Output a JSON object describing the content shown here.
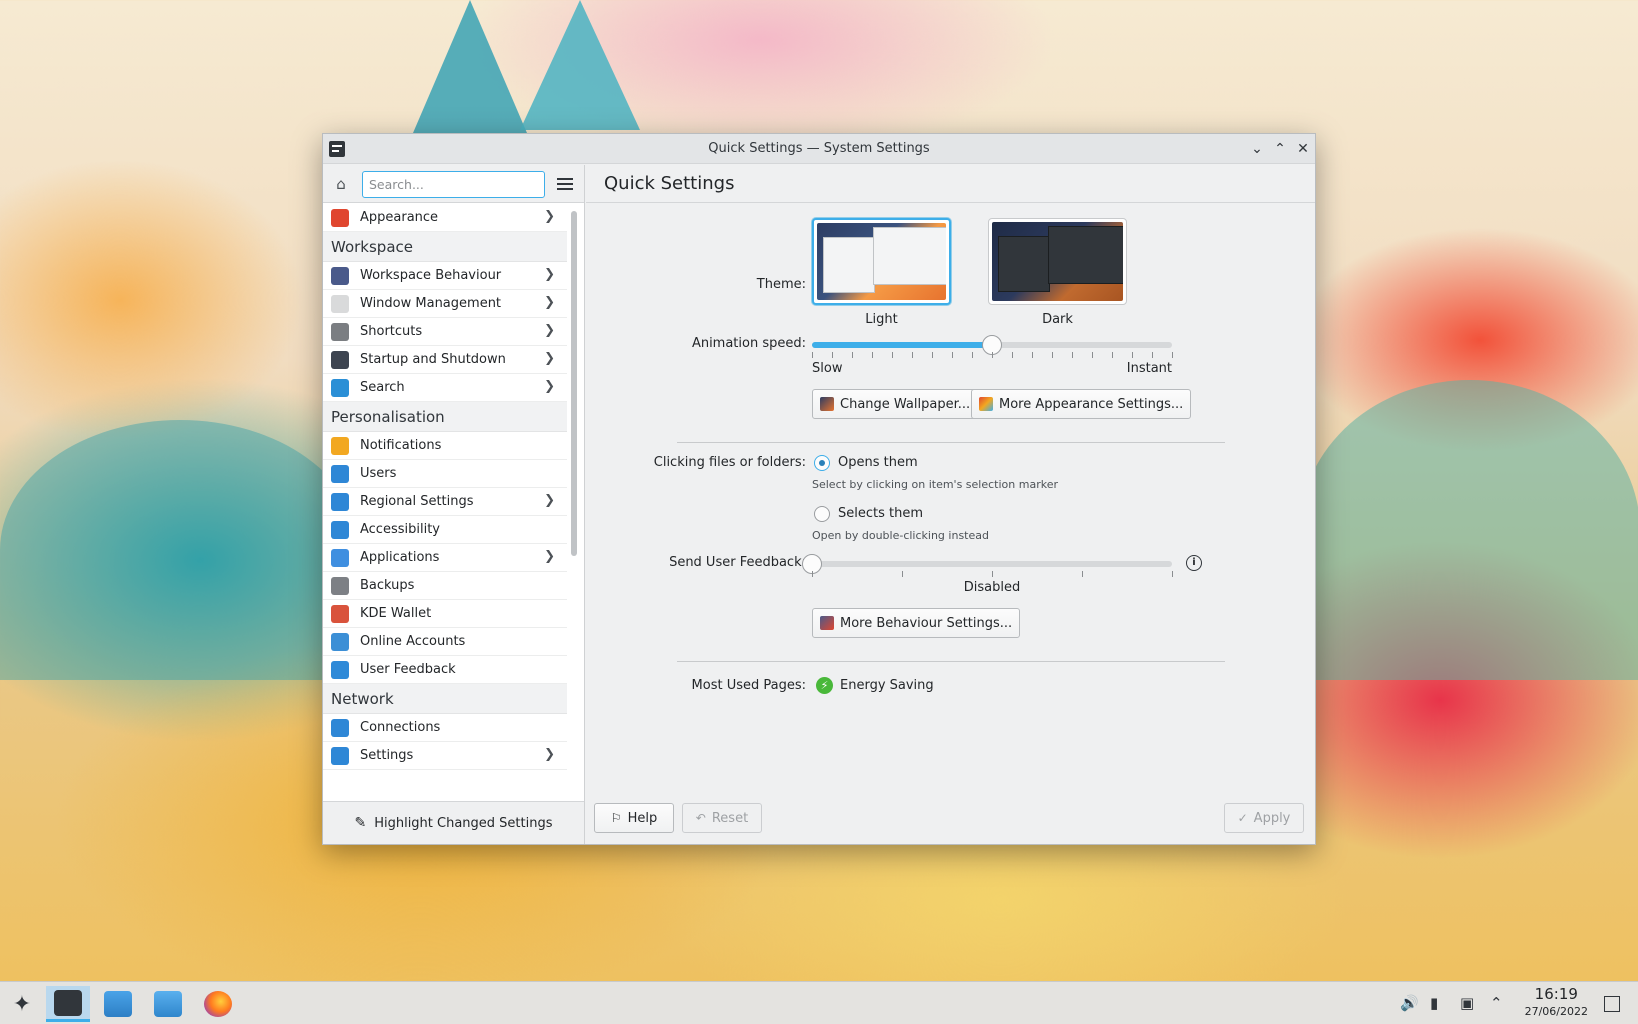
{
  "window": {
    "title": "Quick Settings — System Settings"
  },
  "sidebar": {
    "search_placeholder": "Search...",
    "items": [
      {
        "type": "item",
        "label": "Appearance",
        "chevron": true,
        "icon": "appearance-icon",
        "color": "#e0462f"
      },
      {
        "type": "group",
        "label": "Workspace"
      },
      {
        "type": "item",
        "label": "Workspace Behaviour",
        "chevron": true,
        "icon": "workspace-behaviour-icon",
        "color": "#4a5a8a"
      },
      {
        "type": "item",
        "label": "Window Management",
        "chevron": true,
        "icon": "window-management-icon",
        "color": "#d9dadb"
      },
      {
        "type": "item",
        "label": "Shortcuts",
        "chevron": true,
        "icon": "shortcuts-icon",
        "color": "#7b7e82"
      },
      {
        "type": "item",
        "label": "Startup and Shutdown",
        "chevron": true,
        "icon": "startup-icon",
        "color": "#3d4450"
      },
      {
        "type": "item",
        "label": "Search",
        "chevron": true,
        "icon": "search-icon",
        "color": "#2a8fd6"
      },
      {
        "type": "group",
        "label": "Personalisation"
      },
      {
        "type": "item",
        "label": "Notifications",
        "chevron": false,
        "icon": "bell-icon",
        "color": "#f2a821"
      },
      {
        "type": "item",
        "label": "Users",
        "chevron": false,
        "icon": "users-icon",
        "color": "#2e87d6"
      },
      {
        "type": "item",
        "label": "Regional Settings",
        "chevron": true,
        "icon": "regional-settings-icon",
        "color": "#2e87d6"
      },
      {
        "type": "item",
        "label": "Accessibility",
        "chevron": false,
        "icon": "accessibility-icon",
        "color": "#2e87d6"
      },
      {
        "type": "item",
        "label": "Applications",
        "chevron": true,
        "icon": "applications-icon",
        "color": "#3f8fe0"
      },
      {
        "type": "item",
        "label": "Backups",
        "chevron": false,
        "icon": "backups-icon",
        "color": "#7d8085"
      },
      {
        "type": "item",
        "label": "KDE Wallet",
        "chevron": false,
        "icon": "wallet-icon",
        "color": "#d9533c"
      },
      {
        "type": "item",
        "label": "Online Accounts",
        "chevron": false,
        "icon": "online-accounts-icon",
        "color": "#3c8fd6"
      },
      {
        "type": "item",
        "label": "User Feedback",
        "chevron": false,
        "icon": "feedback-icon",
        "color": "#2f8ad8"
      },
      {
        "type": "group",
        "label": "Network"
      },
      {
        "type": "item",
        "label": "Connections",
        "chevron": false,
        "icon": "connections-icon",
        "color": "#2e87d6"
      },
      {
        "type": "item",
        "label": "Settings",
        "chevron": true,
        "icon": "network-settings-icon",
        "color": "#2e87d6"
      }
    ],
    "highlight_button": "Highlight Changed Settings"
  },
  "main": {
    "heading": "Quick Settings",
    "theme": {
      "label": "Theme:",
      "options": [
        "Light",
        "Dark"
      ],
      "selected": "Light"
    },
    "animation": {
      "label": "Animation speed:",
      "min_label": "Slow",
      "max_label": "Instant",
      "value_fraction": 0.5
    },
    "buttons": {
      "change_wallpaper": "Change Wallpaper...",
      "more_appearance": "More Appearance Settings...",
      "more_behaviour": "More Behaviour Settings..."
    },
    "clicking": {
      "label": "Clicking files or folders:",
      "opens": "Opens them",
      "opens_hint": "Select by clicking on item's selection marker",
      "selects": "Selects them",
      "selects_hint": "Open by double-clicking instead",
      "selected": "Opens them"
    },
    "feedback": {
      "label": "Send User Feedback:",
      "value_label": "Disabled",
      "value_fraction": 0
    },
    "most_used": {
      "label": "Most Used Pages:",
      "page": "Energy Saving"
    },
    "footer": {
      "help": "Help",
      "reset": "Reset",
      "apply": "Apply"
    }
  },
  "taskbar": {
    "time": "16:19",
    "date": "27/06/2022"
  },
  "colors": {
    "accent": "#3daee9",
    "window_bg": "#eff0f1"
  }
}
